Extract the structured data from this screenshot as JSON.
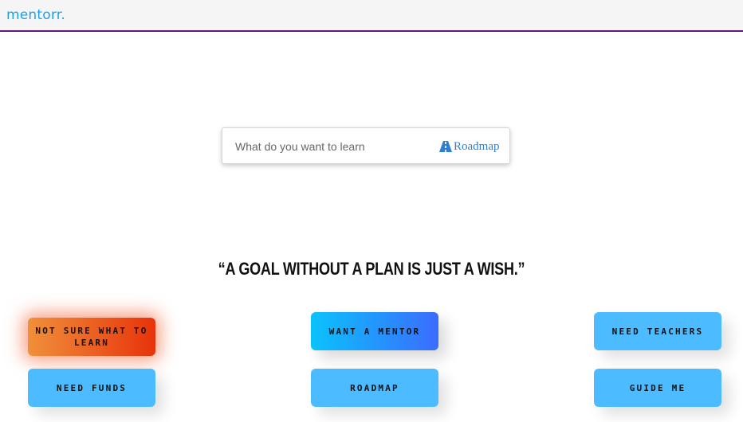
{
  "navbar": {
    "brand": "mentorr."
  },
  "search": {
    "placeholder": "What do you want to learn",
    "roadmap_label": "Roadmap"
  },
  "quote": "“A GOAL WITHOUT A PLAN IS JUST A WISH.”",
  "buttons": {
    "not_sure": "NOT SURE WHAT TO LEARN",
    "want_mentor": "WANT A MENTOR",
    "need_teachers": "NEED TEACHERS",
    "need_funds": "NEED FUNDS",
    "roadmap": "ROADMAP",
    "guide_me": "GUIDE ME"
  },
  "colors": {
    "brand": "#1aa3e8",
    "navbar_border": "#5a1a86",
    "button_blue": "#4dbbff",
    "orange_gradient": [
      "#f0903a",
      "#e8330b"
    ],
    "blue_gradient": [
      "#0bc2fb",
      "#3b6cff"
    ]
  }
}
